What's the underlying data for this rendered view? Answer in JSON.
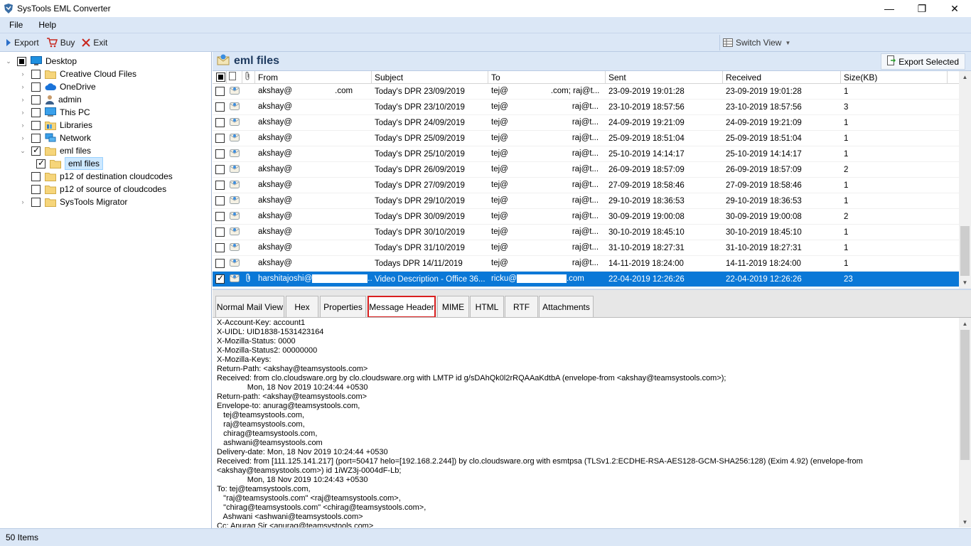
{
  "window": {
    "title": "SysTools EML Converter",
    "minimize": "—",
    "maximize": "❐",
    "close": "✕"
  },
  "menu": [
    "File",
    "Help"
  ],
  "toolbar": {
    "export": "Export",
    "buy": "Buy",
    "exit": "Exit",
    "switch_view": "Switch View"
  },
  "tree": [
    {
      "label": "Desktop",
      "level": 0,
      "expander": "⌄",
      "check": "partial",
      "icon": "desktop-icon"
    },
    {
      "label": "Creative Cloud Files",
      "level": 1,
      "expander": "›",
      "check": "none",
      "icon": "folder-icon"
    },
    {
      "label": "OneDrive",
      "level": 1,
      "expander": "›",
      "check": "none",
      "icon": "cloud-icon"
    },
    {
      "label": "admin",
      "level": 1,
      "expander": "›",
      "check": "none",
      "icon": "user-icon"
    },
    {
      "label": "This PC",
      "level": 1,
      "expander": "›",
      "check": "none",
      "icon": "computer-icon"
    },
    {
      "label": "Libraries",
      "level": 1,
      "expander": "›",
      "check": "none",
      "icon": "library-icon"
    },
    {
      "label": "Network",
      "level": 1,
      "expander": "›",
      "check": "none",
      "icon": "network-icon"
    },
    {
      "label": "eml files",
      "level": 1,
      "expander": "⌄",
      "check": "checked",
      "icon": "folder-icon"
    },
    {
      "label": "eml files",
      "level": 2,
      "expander": "",
      "check": "checked",
      "icon": "folder-icon",
      "selected": true
    },
    {
      "label": "p12 of destination cloudcodes",
      "level": 1,
      "expander": "",
      "check": "none",
      "icon": "folder-icon"
    },
    {
      "label": "p12 of source of cloudcodes",
      "level": 1,
      "expander": "",
      "check": "none",
      "icon": "folder-icon"
    },
    {
      "label": "SysTools Migrator",
      "level": 1,
      "expander": "›",
      "check": "none",
      "icon": "folder-icon"
    }
  ],
  "list": {
    "folder_title": "eml files",
    "export_selected": "Export Selected",
    "columns": [
      "From",
      "Subject",
      "To",
      "Sent",
      "Received",
      "Size(KB)"
    ],
    "rows": [
      {
        "from": "akshay@",
        "from_tail": ".com",
        "subject": "Today's DPR 23/09/2019",
        "to": "tej@",
        "to_tail": ".com; raj@t...",
        "sent": "23-09-2019 19:01:28",
        "received": "23-09-2019 19:01:28",
        "size": "1"
      },
      {
        "from": "akshay@",
        "from_tail": "",
        "subject": "Today's DPR 23/10/2019",
        "to": "tej@",
        "to_tail": "raj@t...",
        "sent": "23-10-2019 18:57:56",
        "received": "23-10-2019 18:57:56",
        "size": "3"
      },
      {
        "from": "akshay@",
        "from_tail": "",
        "subject": "Today's DPR 24/09/2019",
        "to": "tej@",
        "to_tail": "raj@t...",
        "sent": "24-09-2019 19:21:09",
        "received": "24-09-2019 19:21:09",
        "size": "1"
      },
      {
        "from": "akshay@",
        "from_tail": "",
        "subject": "Today's DPR 25/09/2019",
        "to": "tej@",
        "to_tail": "raj@t...",
        "sent": "25-09-2019 18:51:04",
        "received": "25-09-2019 18:51:04",
        "size": "1"
      },
      {
        "from": "akshay@",
        "from_tail": "",
        "subject": "Today's DPR 25/10/2019",
        "to": "tej@",
        "to_tail": "raj@t...",
        "sent": "25-10-2019 14:14:17",
        "received": "25-10-2019 14:14:17",
        "size": "1"
      },
      {
        "from": "akshay@",
        "from_tail": "",
        "subject": "Today's DPR 26/09/2019",
        "to": "tej@",
        "to_tail": "raj@t...",
        "sent": "26-09-2019 18:57:09",
        "received": "26-09-2019 18:57:09",
        "size": "2"
      },
      {
        "from": "akshay@",
        "from_tail": "",
        "subject": "Today's DPR 27/09/2019",
        "to": "tej@",
        "to_tail": "raj@t...",
        "sent": "27-09-2019 18:58:46",
        "received": "27-09-2019 18:58:46",
        "size": "1"
      },
      {
        "from": "akshay@",
        "from_tail": "",
        "subject": "Today's DPR 29/10/2019",
        "to": "tej@",
        "to_tail": "raj@t...",
        "sent": "29-10-2019 18:36:53",
        "received": "29-10-2019 18:36:53",
        "size": "1"
      },
      {
        "from": "akshay@",
        "from_tail": "",
        "subject": "Today's DPR 30/09/2019",
        "to": "tej@",
        "to_tail": "raj@t...",
        "sent": "30-09-2019 19:00:08",
        "received": "30-09-2019 19:00:08",
        "size": "2"
      },
      {
        "from": "akshay@",
        "from_tail": "",
        "subject": "Today's DPR 30/10/2019",
        "to": "tej@",
        "to_tail": "raj@t...",
        "sent": "30-10-2019 18:45:10",
        "received": "30-10-2019 18:45:10",
        "size": "1"
      },
      {
        "from": "akshay@",
        "from_tail": "",
        "subject": "Today's DPR 31/10/2019",
        "to": "tej@",
        "to_tail": "raj@t...",
        "sent": "31-10-2019 18:27:31",
        "received": "31-10-2019 18:27:31",
        "size": "1"
      },
      {
        "from": "akshay@",
        "from_tail": "",
        "subject": "Todays DPR 14/11/2019",
        "to": "tej@",
        "to_tail": "raj@t...",
        "sent": "14-11-2019 18:24:00",
        "received": "14-11-2019 18:24:00",
        "size": "1"
      },
      {
        "from": "harshitajoshi@",
        "from_tail": "...",
        "subject": "Video Description - Office 36...",
        "to": "ricku@",
        "to_tail": ".com",
        "sent": "22-04-2019 12:26:26",
        "received": "22-04-2019 12:26:26",
        "size": "23",
        "selected": true
      }
    ]
  },
  "tabs": [
    "Normal Mail View",
    "Hex",
    "Properties",
    "Message Header",
    "MIME",
    "HTML",
    "RTF",
    "Attachments"
  ],
  "active_tab": "Message Header",
  "header_lines": [
    "X-Account-Key: account1",
    "X-UIDL: UID1838-1531423164",
    "X-Mozilla-Status: 0000",
    "X-Mozilla-Status2: 00000000",
    "X-Mozilla-Keys:",
    "Return-Path: <akshay@teamsystools.com>",
    "Received: from clo.cloudsware.org by clo.cloudsware.org with LMTP id g/sDAhQk0l2rRQAAaKdtbA (envelope-from <akshay@teamsystools.com>);",
    "              Mon, 18 Nov 2019 10:24:44 +0530",
    "Return-path: <akshay@teamsystools.com>",
    "Envelope-to: anurag@teamsystools.com,",
    "   tej@teamsystools.com,",
    "   raj@teamsystools.com,",
    "   chirag@teamsystools.com,",
    "   ashwani@teamsystools.com",
    "Delivery-date: Mon, 18 Nov 2019 10:24:44 +0530",
    "Received: from [111.125.141.217] (port=50417 helo=[192.168.2.244]) by clo.cloudsware.org with esmtpsa (TLSv1.2:ECDHE-RSA-AES128-GCM-SHA256:128) (Exim 4.92) (envelope-from",
    "<akshay@teamsystools.com>) id 1iWZ3j-0004dF-Lb;",
    "              Mon, 18 Nov 2019 10:24:43 +0530",
    "To: tej@teamsystools.com,",
    "   \"raj@teamsystools.com\" <raj@teamsystools.com>,",
    "   \"chirag@teamsystools.com\" <chirag@teamsystools.com>,",
    "   Ashwani <ashwani@teamsystools.com>",
    "Cc: Anurag Sir <anurag@teamsystools.com>"
  ],
  "status": {
    "items": "50 Items"
  },
  "colors": {
    "accent": "#0a78d7",
    "chrome": "#dbe7f6",
    "highlight_border": "#d92020"
  }
}
